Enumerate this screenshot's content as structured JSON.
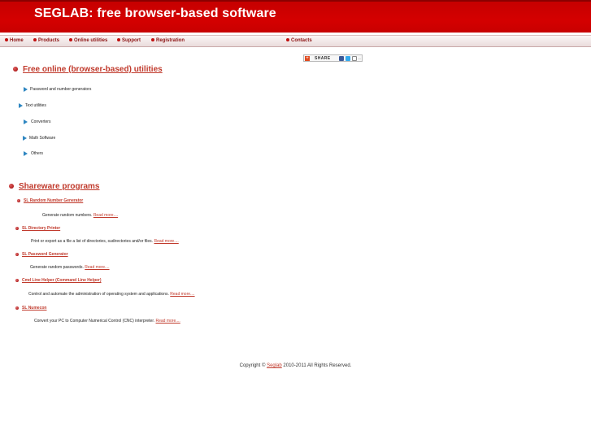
{
  "header": {
    "title": "SEGLAB: free browser-based software"
  },
  "nav": {
    "items": [
      {
        "label": "Home"
      },
      {
        "label": "Products"
      },
      {
        "label": "Online utilities"
      },
      {
        "label": "Support"
      },
      {
        "label": "Registration"
      },
      {
        "label": "Contacts"
      }
    ]
  },
  "share": {
    "label": "SHARE"
  },
  "utilities": {
    "heading": "Free online (browser-based) utilities",
    "items": [
      {
        "label": "Password and number generators"
      },
      {
        "label": "Text utilities"
      },
      {
        "label": "Converters"
      },
      {
        "label": "Math Software"
      },
      {
        "label": "Others"
      }
    ]
  },
  "shareware": {
    "heading": "Shareware programs",
    "read_more_label": "Read more....",
    "programs": [
      {
        "title": "SL Random Number Generator",
        "description": "Generate random numbers."
      },
      {
        "title": "SL Directory Printer",
        "description": "Print or export as a file a list of directories, sudirectories and/or files."
      },
      {
        "title": "SL Password Generator",
        "description": "Generate random passwords."
      },
      {
        "title": "Cmd Line Helper (Command Line Helper)",
        "description": "Control and automate the administration of operating system and applications."
      },
      {
        "title": "SL Numecon",
        "description": "Convert your PC to Computer Numerical Control (CNC) interpreter."
      }
    ]
  },
  "footer": {
    "prefix": "Copyright ©",
    "brand": "Seglab",
    "suffix": "2010-2011 All Rights Reserved."
  },
  "colors": {
    "header_red": "#d40000",
    "link_red": "#c0392b",
    "arrow_blue": "#2e86c1"
  }
}
